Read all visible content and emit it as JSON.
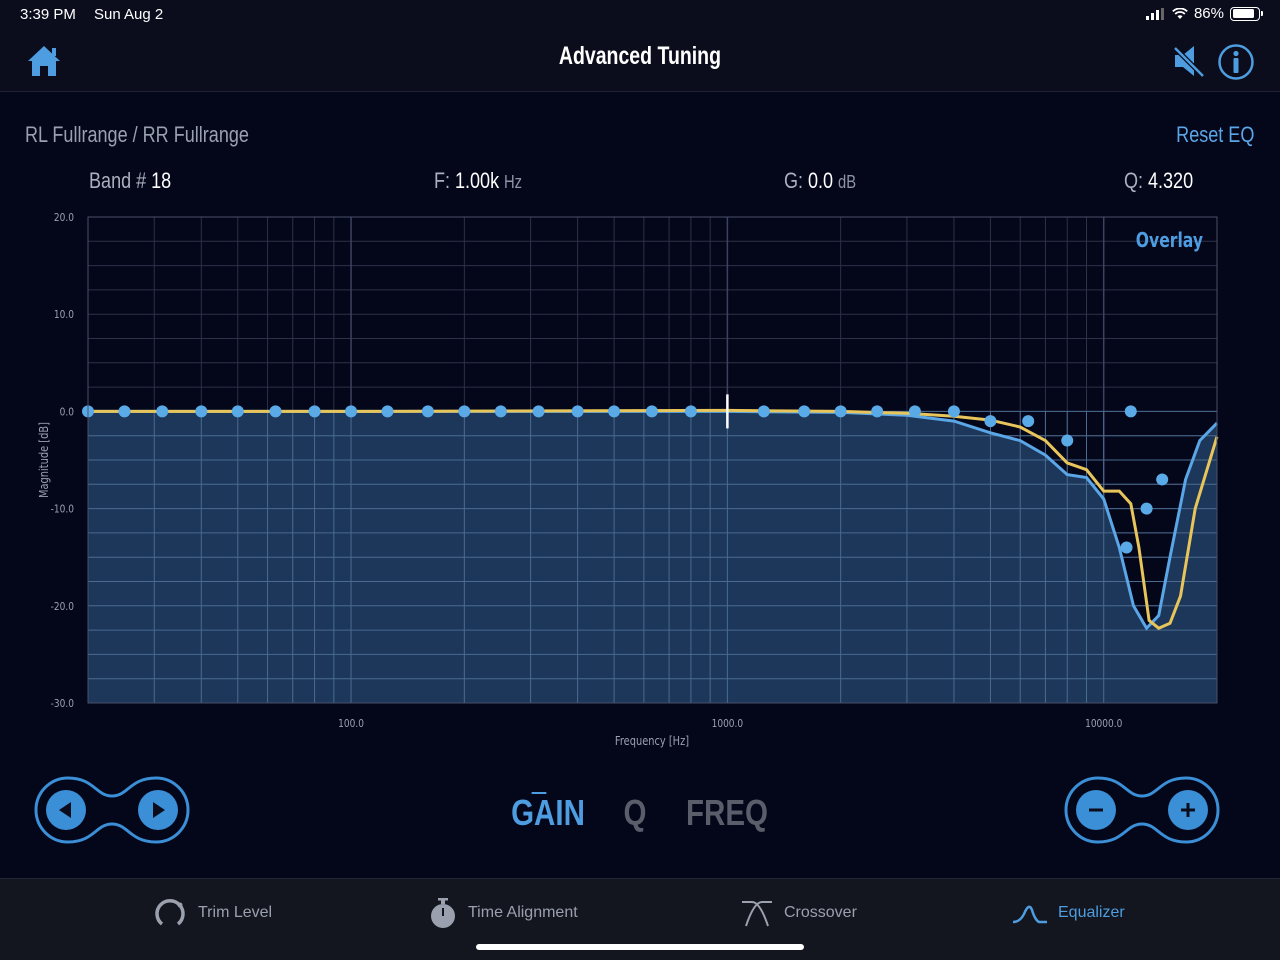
{
  "status_bar": {
    "time": "3:39 PM",
    "date": "Sun Aug 2",
    "battery": "86%",
    "battery_level": 0.86
  },
  "nav": {
    "title": "Advanced Tuning",
    "icons": [
      "home-icon",
      "speaker-mute-icon",
      "info-icon"
    ]
  },
  "header": {
    "channel": "RL Fullrange / RR Fullrange",
    "reset": "Reset EQ"
  },
  "params": {
    "band_label": "Band #",
    "band_value": "18",
    "freq_label": "F:",
    "freq_value": "1.00k",
    "freq_unit": "Hz",
    "gain_label": "G:",
    "gain_value": "0.0",
    "gain_unit": "dB",
    "q_label": "Q:",
    "q_value": "4.320"
  },
  "modes": {
    "gain": "GAIN",
    "q": "Q",
    "freq": "FREQ",
    "selected": "GAIN"
  },
  "tabs": [
    {
      "label": "Trim Level",
      "icon": "trim-knob-icon"
    },
    {
      "label": "Time Alignment",
      "icon": "stopwatch-icon"
    },
    {
      "label": "Crossover",
      "icon": "crossover-icon"
    },
    {
      "label": "Equalizer",
      "icon": "equalizer-icon",
      "active": true
    }
  ],
  "colors": {
    "accent": "#4d9de0",
    "overlay_curve": "#e8c55a",
    "response_curve": "#5aa6e6",
    "fill": "#1d3a5e",
    "background": "#04061a"
  },
  "chart_data": {
    "type": "line",
    "xscale": "log",
    "xlim": [
      20,
      20000
    ],
    "ylim": [
      -30,
      20
    ],
    "xlabel": "Frequency [Hz]",
    "ylabel": "Magnitude [dB]",
    "x_tick_labels": [
      "100.0",
      "1000.0",
      "10000.0"
    ],
    "y_tick_labels": [
      "20.0",
      "10.0",
      "0.0",
      "-10.0",
      "-20.0",
      "-30.0"
    ],
    "overlay_label": "Overlay",
    "selected_band_freq": 1000,
    "band_points": [
      {
        "f": 20,
        "g": 0
      },
      {
        "f": 25,
        "g": 0
      },
      {
        "f": 31.5,
        "g": 0
      },
      {
        "f": 40,
        "g": 0
      },
      {
        "f": 50,
        "g": 0
      },
      {
        "f": 63,
        "g": 0
      },
      {
        "f": 80,
        "g": 0
      },
      {
        "f": 100,
        "g": 0
      },
      {
        "f": 125,
        "g": 0
      },
      {
        "f": 160,
        "g": 0
      },
      {
        "f": 200,
        "g": 0
      },
      {
        "f": 250,
        "g": 0
      },
      {
        "f": 315,
        "g": 0
      },
      {
        "f": 400,
        "g": 0
      },
      {
        "f": 500,
        "g": 0
      },
      {
        "f": 630,
        "g": 0
      },
      {
        "f": 800,
        "g": 0
      },
      {
        "f": 1250,
        "g": 0
      },
      {
        "f": 1600,
        "g": 0
      },
      {
        "f": 2000,
        "g": 0
      },
      {
        "f": 2500,
        "g": 0
      },
      {
        "f": 3150,
        "g": 0
      },
      {
        "f": 4000,
        "g": 0
      },
      {
        "f": 5000,
        "g": -1
      },
      {
        "f": 6300,
        "g": -1
      },
      {
        "f": 8000,
        "g": -3
      },
      {
        "f": 11800,
        "g": 0
      },
      {
        "f": 11500,
        "g": -14
      },
      {
        "f": 13000,
        "g": -10
      },
      {
        "f": 14300,
        "g": -7
      }
    ],
    "series": [
      {
        "name": "Overlay",
        "color": "#e8c55a",
        "points": [
          [
            20,
            0
          ],
          [
            100,
            0
          ],
          [
            1000,
            0.1
          ],
          [
            2000,
            0
          ],
          [
            3000,
            -0.2
          ],
          [
            4000,
            -0.5
          ],
          [
            5000,
            -0.9
          ],
          [
            6000,
            -1.6
          ],
          [
            7000,
            -3
          ],
          [
            8000,
            -5.3
          ],
          [
            9000,
            -6
          ],
          [
            10000,
            -8.2
          ],
          [
            11000,
            -8.2
          ],
          [
            11800,
            -9.5
          ],
          [
            12400,
            -14
          ],
          [
            13200,
            -21.5
          ],
          [
            14000,
            -22.3
          ],
          [
            15000,
            -21.8
          ],
          [
            16000,
            -19
          ],
          [
            17500,
            -10
          ],
          [
            20000,
            -2.6
          ]
        ]
      },
      {
        "name": "",
        "color": "#5aa6e6",
        "points": [
          [
            20,
            0
          ],
          [
            100,
            0
          ],
          [
            1000,
            0
          ],
          [
            2000,
            -0.1
          ],
          [
            3000,
            -0.4
          ],
          [
            4000,
            -1
          ],
          [
            5000,
            -2.2
          ],
          [
            6000,
            -3
          ],
          [
            7000,
            -4.5
          ],
          [
            8000,
            -6.5
          ],
          [
            9000,
            -6.8
          ],
          [
            10000,
            -9
          ],
          [
            11000,
            -14
          ],
          [
            12000,
            -20
          ],
          [
            13000,
            -22.3
          ],
          [
            14000,
            -21
          ],
          [
            15000,
            -15
          ],
          [
            16500,
            -7
          ],
          [
            18000,
            -3
          ],
          [
            20000,
            -1.2
          ]
        ]
      }
    ]
  }
}
